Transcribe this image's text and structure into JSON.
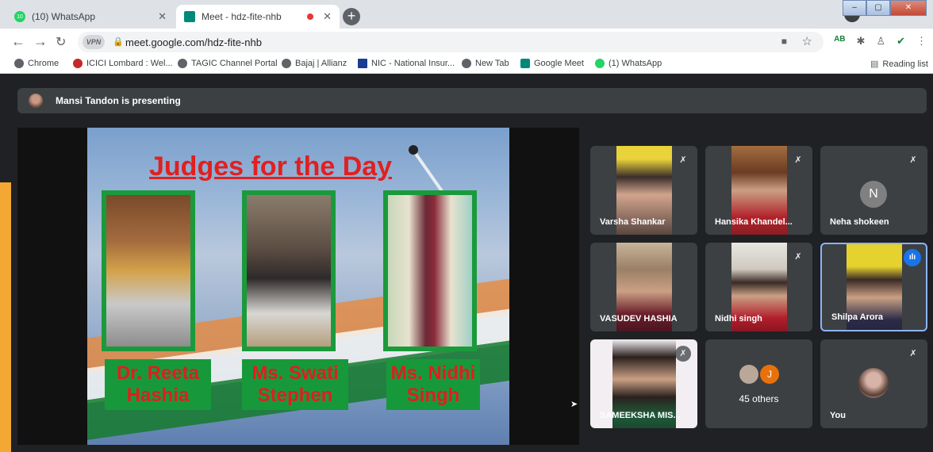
{
  "browser": {
    "tabs": [
      {
        "title": "(10) WhatsApp",
        "active": false,
        "favicon": "whatsapp-icon",
        "badge": "10"
      },
      {
        "title": "Meet - hdz-fite-nhb",
        "active": true,
        "favicon": "google-meet-icon",
        "recording": true
      }
    ],
    "vpn_label": "VPN",
    "url": "meet.google.com/hdz-fite-nhb",
    "bookmarks": [
      {
        "label": "Chrome",
        "icon": "chrome-icon"
      },
      {
        "label": "ICICI Lombard : Wel...",
        "icon": "icici-icon"
      },
      {
        "label": "TAGIC Channel Portal",
        "icon": "globe-icon"
      },
      {
        "label": "Bajaj | Allianz",
        "icon": "globe-icon"
      },
      {
        "label": "NIC - National Insur...",
        "icon": "nic-icon"
      },
      {
        "label": "New Tab",
        "icon": "globe-icon"
      },
      {
        "label": "Google Meet",
        "icon": "google-meet-icon"
      },
      {
        "label": "(1) WhatsApp",
        "icon": "whatsapp-icon"
      }
    ],
    "reading_list": "Reading list",
    "profile_badge": "AB"
  },
  "meet": {
    "presenting_banner": "Mansi Tandon is presenting",
    "slide": {
      "title": "Judges for the Day",
      "judges": [
        {
          "name": "Dr. Reeta\nHashia"
        },
        {
          "name": "Ms. Swati\nStephen"
        },
        {
          "name": "Ms. Nidhi\nSingh"
        }
      ]
    },
    "participants": [
      {
        "name": "Varsha Shankar",
        "muted": true,
        "video": true
      },
      {
        "name": "Hansika Khandel...",
        "muted": true,
        "video": true
      },
      {
        "name": "Neha shokeen",
        "muted": true,
        "video": false,
        "initial": "N"
      },
      {
        "name": "VASUDEV HASHIA",
        "muted": false,
        "video": true
      },
      {
        "name": "Nidhi singh",
        "muted": true,
        "video": true
      },
      {
        "name": "Shilpa Arora",
        "muted": false,
        "video": true,
        "speaking": true
      },
      {
        "name": "SAMEEKSHA MIS...",
        "muted": true,
        "video": true
      },
      {
        "name": "45 others",
        "others_avatar_initial": "J"
      },
      {
        "name": "You",
        "muted": true,
        "video": false
      }
    ]
  },
  "colors": {
    "meet_bg": "#202124",
    "tile_bg": "#3c4043",
    "slide_title_red": "#e02020",
    "judge_green": "#17993b",
    "speaking_blue": "#1a73e8"
  }
}
